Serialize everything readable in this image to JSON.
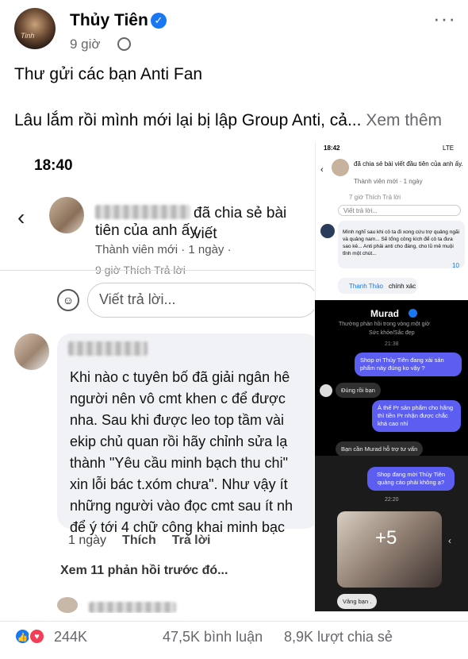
{
  "post": {
    "author": "Thủy Tiên",
    "time": "9 giờ",
    "title_line": "Thư gửi các bạn Anti Fan",
    "body_line": "Lâu lắm rồi mình mới lại bị lập Group Anti, cả...",
    "see_more": "Xem thêm",
    "avatar_caption": "Tinh",
    "icons": {
      "verified": "verified-badge-icon",
      "privacy": "globe-icon",
      "menu": "more-options-icon"
    }
  },
  "screenshot_main": {
    "clock": "18:40",
    "shared_text_1": "đã chia sẻ bài viết",
    "shared_text_2": "tiên của anh ấy.",
    "member_badge": "Thành viên mới · 1 ngày ·",
    "cut_row": "9 giờ     Thích     Trả lời",
    "reply_placeholder": "Viết trả lời...",
    "comment_lines": "Khi nào c tuyên bố đã giải ngân hê\nngười nên vô cmt khen c để được\nnha. Sau khi được leo top tầm vài \nekip chủ quan rồi hãy chỉnh sửa lạ\nthành \"Yêu cầu minh bạch thu chi\"\nxin lỗi bác t.xóm chưa\". Như vậy ít \nnhững người vào đọc cmt sau ít nh\nđể ý tới 4 chữ công khai minh bạc",
    "comment_time": "1 ngày",
    "like": "Thích",
    "reply": "Trả lời",
    "prev_replies": "Xem 11 phản hồi trước đó..."
  },
  "panel_top": {
    "clock": "18:42",
    "status": "LTE",
    "shared": "đã chia sẻ bài viết đầu tiên của anh ấy.",
    "member": "Thành viên mới · 1 ngày",
    "actions": "7 giờ    Thích    Trả lời",
    "reply_placeholder": "Viết trả lời...",
    "comment": "Mình nghĩ sau khi cô ta đi xong cứu trợ quảng ngãi và quảng nam... Sẽ tổng công kích để cô ta đưa sao kê... Anti phải anti cho đáng, cho lũ mê muội tỉnh một chút...",
    "reply_name": "Thanh Thảo",
    "reply_text": "chính xác",
    "reaction_count": "10"
  },
  "panel_mid": {
    "page_name": "Murad",
    "subtitle": "Thường phản hồi trong vòng một giờ",
    "category": "Sức khỏe/Sắc đẹp",
    "time": "21:38",
    "msg1": "Shop ơi Thủy Tiên đang xài sản phẩm này đúng ko vậy ?",
    "msg2": "Đúng rồi bạn",
    "msg3": "À thế Pr sản phẩm cho hãng thì tiền Pr nhận được chắc khá cao nhỉ",
    "msg4": "Bạn cần Murad hỗ trợ tư vấn"
  },
  "panel_bottom": {
    "msg1": "Shop đang mời Thủy Tiên quảng cáo phải không ạ?",
    "time": "22:20",
    "overlay": "+5",
    "reply": "Vâng bạn ."
  },
  "stats": {
    "reactions": "244K",
    "comments": "47,5K bình luận",
    "shares": "8,9K lượt chia sẻ"
  }
}
